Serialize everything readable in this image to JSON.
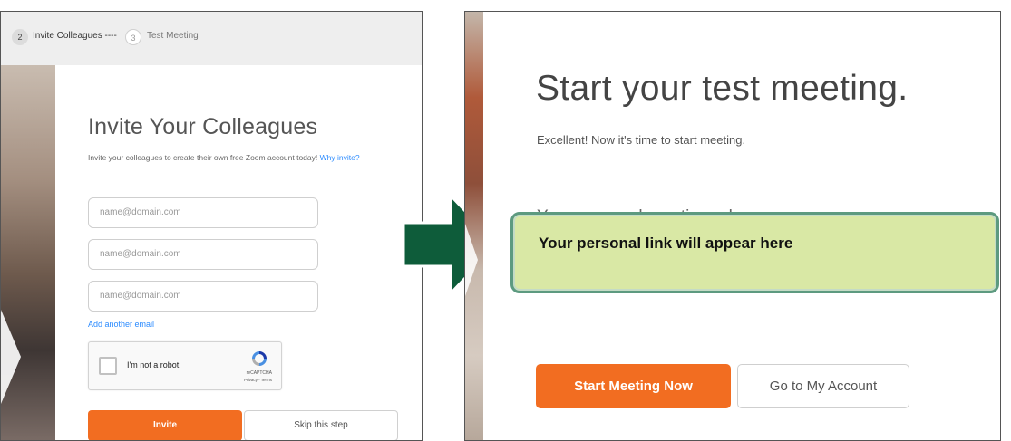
{
  "left": {
    "steps": [
      {
        "number": "2",
        "label": "Invite Colleagues ----"
      },
      {
        "number": "3",
        "label": "Test Meeting"
      }
    ],
    "title": "Invite Your Colleagues",
    "subtitle": "Invite your colleagues to create their own free Zoom account today!",
    "why_link": "Why invite?",
    "email_placeholders": [
      "name@domain.com",
      "name@domain.com",
      "name@domain.com"
    ],
    "add_email": "Add another email",
    "recaptcha": {
      "label": "I'm not a robot",
      "brand": "reCAPTCHA",
      "terms": "Privacy - Terms"
    },
    "invite_button": "Invite",
    "skip_button": "Skip this step",
    "colors": {
      "accent": "#f26d21",
      "link": "#2d8cff"
    }
  },
  "arrow": {
    "color": "#0e5c3a",
    "icon": "right-arrow-icon"
  },
  "right": {
    "title": "Start your test meeting.",
    "subtitle": "Excellent! Now it's time to start meeting.",
    "url_label": "Your personal meeting url:",
    "overlay_text": "Your personal link will appear here",
    "start_button": "Start Meeting Now",
    "account_button": "Go to My Account",
    "colors": {
      "accent": "#f26d21",
      "overlay_fill": "#d9e8a5",
      "overlay_border": "#5d9a80"
    }
  }
}
